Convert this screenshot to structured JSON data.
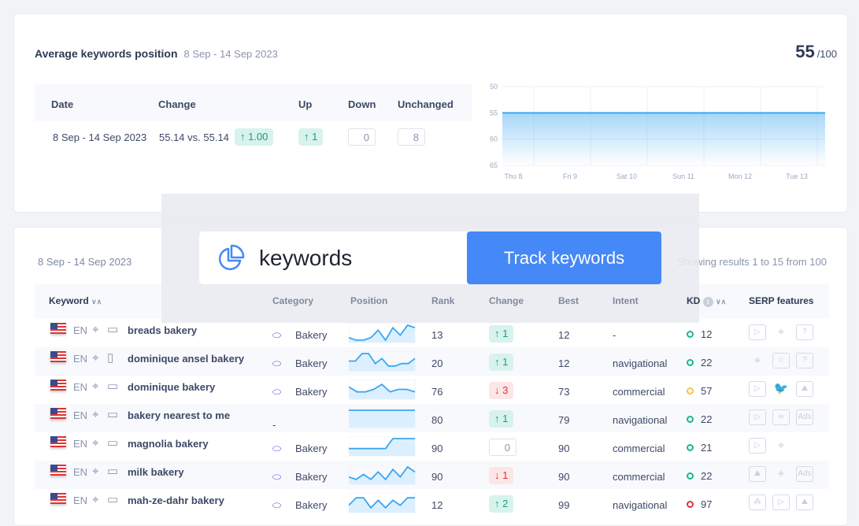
{
  "summary": {
    "title": "Average keywords position",
    "range": "8 Sep - 14 Sep 2023",
    "score": "55",
    "score_max": "/100",
    "headers": [
      "Date",
      "Change",
      "Up",
      "Down",
      "Unchanged"
    ],
    "row": {
      "date": "8 Sep - 14 Sep 2023",
      "change": "55.14 vs. 55.14",
      "change_badge": "↑ 1.00",
      "up": "↑ 1",
      "down": "0",
      "unchanged": "8"
    }
  },
  "chart_data": {
    "type": "area",
    "x": [
      "Thu 8",
      "Fri 9",
      "Sat 10",
      "Sun 11",
      "Mon 12",
      "Tue 13"
    ],
    "values": [
      55,
      55,
      55,
      55,
      55,
      55,
      55
    ],
    "yticks": [
      "50",
      "55",
      "60",
      "65"
    ],
    "ylim": [
      50,
      65
    ],
    "y_inverted": true,
    "grid": true,
    "color": "#3aa6f0"
  },
  "promo": {
    "brand": "keywords",
    "cta": "Track keywords"
  },
  "table": {
    "range": "8 Sep - 14 Sep 2023",
    "results": "Showing results 1 to 15 from 100",
    "headers": [
      "Keyword",
      "Category",
      "Position",
      "Rank",
      "Change",
      "Best",
      "Intent",
      "KD",
      "SERP features"
    ],
    "rows": [
      {
        "lang": "EN",
        "device": "desktop",
        "keyword": "breads bakery",
        "category": "Bakery",
        "spark": [
          5,
          6,
          6,
          5,
          2,
          6,
          1,
          4,
          0,
          1
        ],
        "rank": "13",
        "change": "↑ 1",
        "dir": "up",
        "best": "12",
        "intent": "-",
        "kd_color": "#17b890",
        "kd": "12",
        "serp": [
          "video-icon",
          "map-pin-icon",
          "question-icon"
        ]
      },
      {
        "lang": "EN",
        "device": "mobile",
        "keyword": "dominique ansel bakery",
        "category": "Bakery",
        "spark": [
          3,
          3,
          0,
          0,
          4,
          2,
          5,
          5,
          4,
          4,
          2
        ],
        "rank": "20",
        "change": "↑ 1",
        "dir": "up",
        "best": "12",
        "intent": "navigational",
        "kd_color": "#17b890",
        "kd": "22",
        "serp": [
          "map-pin-icon",
          "no-star-icon",
          "question-icon"
        ]
      },
      {
        "lang": "EN",
        "device": "desktop",
        "keyword": "dominique bakery",
        "category": "Bakery",
        "spark": [
          2,
          4,
          4,
          3,
          1,
          4,
          3,
          3,
          4
        ],
        "rank": "76",
        "change": "↓ 3",
        "dir": "down",
        "best": "73",
        "intent": "commercial",
        "kd_color": "#f6c343",
        "kd": "57",
        "serp": [
          "video-icon",
          "twitter-icon",
          "image-icon"
        ]
      },
      {
        "lang": "EN",
        "device": "desktop",
        "keyword": "bakery nearest to me",
        "category": "-",
        "spark": [
          0,
          0,
          0,
          0
        ],
        "rank": "80",
        "change": "↑ 1",
        "dir": "up",
        "best": "79",
        "intent": "navigational",
        "kd_color": "#17b890",
        "kd": "22",
        "serp": [
          "video-icon",
          "link-icon",
          "ads-icon"
        ]
      },
      {
        "lang": "EN",
        "device": "desktop",
        "keyword": "magnolia bakery",
        "category": "Bakery",
        "spark": [
          4,
          4,
          4,
          4,
          4,
          4,
          0,
          0,
          0,
          0
        ],
        "rank": "90",
        "change": "0",
        "dir": "none",
        "best": "90",
        "intent": "commercial",
        "kd_color": "#17b890",
        "kd": "21",
        "serp": [
          "video-icon",
          "map-pin-icon"
        ]
      },
      {
        "lang": "EN",
        "device": "desktop",
        "keyword": "milk bakery",
        "category": "Bakery",
        "spark": [
          4,
          5,
          3,
          5,
          2,
          5,
          1,
          4,
          0,
          2
        ],
        "rank": "90",
        "change": "↓ 1",
        "dir": "down",
        "best": "90",
        "intent": "commercial",
        "kd_color": "#17b890",
        "kd": "22",
        "serp": [
          "image-icon",
          "map-pin-icon",
          "ads-icon"
        ]
      },
      {
        "lang": "EN",
        "device": "desktop",
        "keyword": "mah-ze-dahr bakery",
        "category": "Bakery",
        "spark": [
          4,
          1,
          1,
          5,
          2,
          5,
          2,
          4,
          1,
          1
        ],
        "rank": "12",
        "change": "↑ 2",
        "dir": "up",
        "best": "99",
        "intent": "navigational",
        "kd_color": "#e0313a",
        "kd": "97",
        "serp": [
          "stars-icon",
          "video-icon",
          "image-icon"
        ]
      }
    ]
  }
}
